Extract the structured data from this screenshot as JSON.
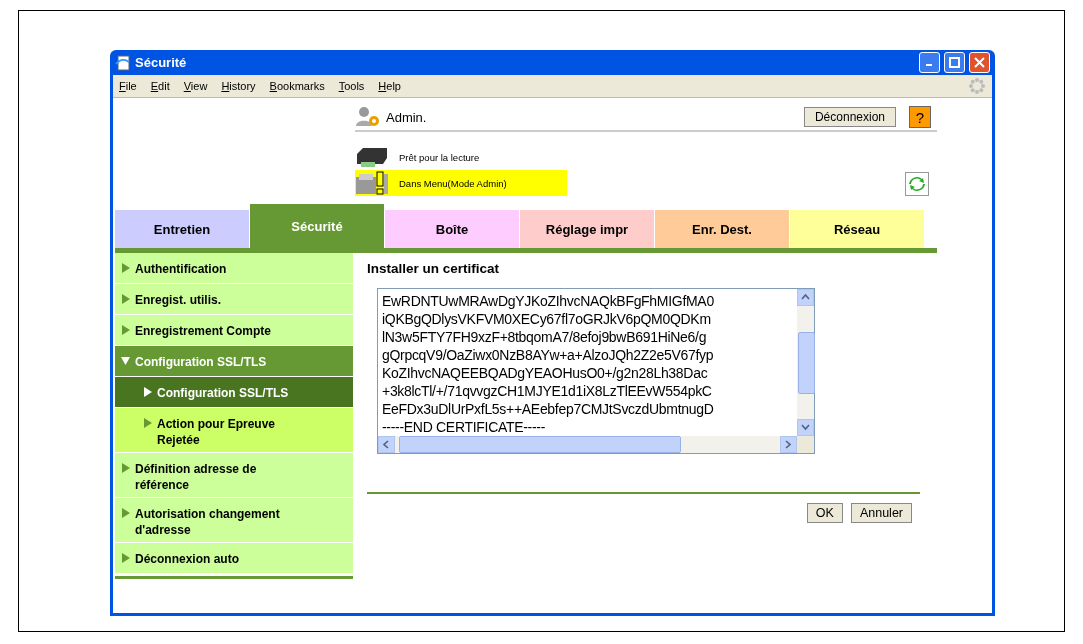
{
  "window": {
    "title": "Sécurité"
  },
  "menu": [
    "File",
    "Edit",
    "View",
    "History",
    "Bookmarks",
    "Tools",
    "Help"
  ],
  "header": {
    "user": "Admin.",
    "logout": "Déconnexion",
    "help": "?",
    "status": [
      {
        "text": "Prêt pour la lecture",
        "highlighted": false,
        "kind": "printer"
      },
      {
        "text": "Dans Menu(Mode Admin)",
        "highlighted": true,
        "kind": "warning"
      }
    ]
  },
  "tabs": [
    {
      "label": "Entretien",
      "selected": false,
      "color": "#ccccff"
    },
    {
      "label": "Sécurité",
      "selected": true,
      "color": "#669933"
    },
    {
      "label": "Boîte",
      "selected": false,
      "color": "#ffccff"
    },
    {
      "label": "Réglage impr",
      "selected": false,
      "color": "#ffcccc"
    },
    {
      "label": "Enr. Dest.",
      "selected": false,
      "color": "#ffcc99"
    },
    {
      "label": "Réseau",
      "selected": false,
      "color": "#ffff99"
    }
  ],
  "sidebar": {
    "items": [
      {
        "label": "Authentification",
        "expanded": false,
        "selected": false,
        "highlighted": false
      },
      {
        "label": "Enregist. utilis.",
        "expanded": false,
        "selected": false,
        "highlighted": false
      },
      {
        "label": "Enregistrement Compte",
        "expanded": false,
        "selected": false,
        "highlighted": false
      },
      {
        "label": "Configuration SSL/TLS",
        "expanded": true,
        "selected": false,
        "highlighted": false,
        "children": [
          {
            "label": "Configuration SSL/TLS",
            "expanded": false,
            "selected": true,
            "highlighted": false
          },
          {
            "label": "Action pour Epreuve Rejetée",
            "expanded": false,
            "selected": false,
            "highlighted": true
          }
        ]
      },
      {
        "label": "Définition adresse de référence",
        "expanded": false,
        "selected": false,
        "highlighted": false
      },
      {
        "label": "Autorisation changement d'adresse",
        "expanded": false,
        "selected": false,
        "highlighted": false
      },
      {
        "label": "Déconnexion auto",
        "expanded": false,
        "selected": false,
        "highlighted": false
      }
    ]
  },
  "main": {
    "title": "Installer un certificat",
    "certificate": [
      "EwRDNTUwMRAwDgYJKoZIhvcNAQkBFgFhMIGfMA0",
      "iQKBgQDlysVKFVM0XECy67fl7oGRJkV6pQM0QDKm",
      "lN3w5FTY7FH9xzF+8tbqomA7/8efoj9bwB691HiNe6/g",
      "gQrpcqV9/OaZiwx0NzB8AYw+a+AlzoJQh2Z2e5V67fyp",
      "KoZIhvcNAQEEBQADgYEAOHusO0+/g2n28Lh38Dac",
      "+3k8lcTl/+/71qvvgzCH1MJYE1d1iX8LzTlEEvW554pkC",
      "EeFDx3uDlUrPxfL5s++AEebfep7CMJtSvczdUbmtnugD",
      "-----END CERTIFICATE-----"
    ],
    "buttons": [
      "OK",
      "Annuler"
    ]
  }
}
